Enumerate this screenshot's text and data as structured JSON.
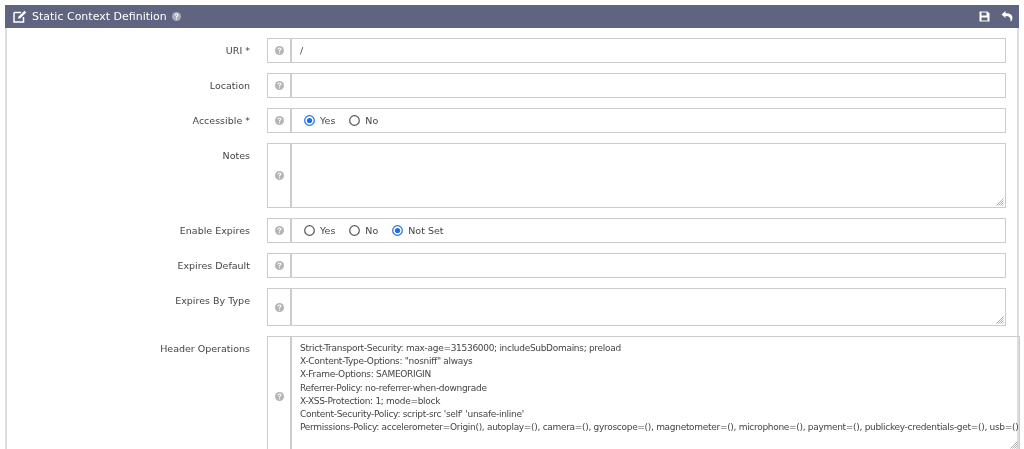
{
  "panel": {
    "title": "Static Context Definition"
  },
  "fields": [
    {
      "label": "URI *",
      "kind": "text",
      "value": "/"
    },
    {
      "label": "Location",
      "kind": "text"
    },
    {
      "label": "Accessible *",
      "kind": "radio",
      "options": [
        {
          "label": "Yes",
          "selected": true
        },
        {
          "label": "No",
          "selected": false
        }
      ]
    },
    {
      "label": "Notes",
      "kind": "memo"
    },
    {
      "label": "Enable Expires",
      "kind": "radio",
      "options": [
        {
          "label": "Yes",
          "selected": false
        },
        {
          "label": "No",
          "selected": false
        },
        {
          "label": "Not Set",
          "selected": true
        }
      ]
    },
    {
      "label": "Expires Default",
      "kind": "text"
    },
    {
      "label": "Expires By Type",
      "kind": "textarea"
    },
    {
      "label": "Header Operations",
      "kind": "editor",
      "value": "Strict-Transport-Security: max-age=31536000; includeSubDomains; preload\nX-Content-Type-Options: \"nosniff\" always\nX-Frame-Options: SAMEORIGIN\nReferrer-Policy: no-referrer-when-downgrade\nX-XSS-Protection: 1; mode=block\nContent-Security-Policy: script-src 'self' 'unsafe-inline'\nPermissions-Policy: accelerometer=Origin(), autoplay=(), camera=(), gyroscope=(), magnetometer=(), microphone=(), payment=(), publickey-credentials-get=(), usb=()"
    }
  ]
}
